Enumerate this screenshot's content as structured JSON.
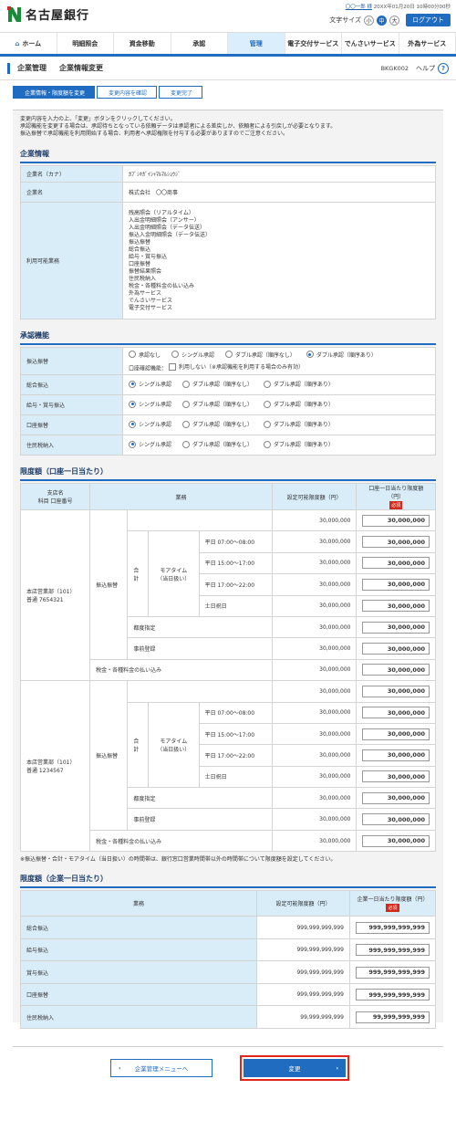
{
  "header": {
    "bank_name": "名古屋銀行",
    "user_name": "〇〇一郎 様",
    "last_login": "20XX年01月20日 10時00分00秒",
    "font_size_label": "文字サイズ",
    "font_sizes": [
      "小",
      "中",
      "大"
    ],
    "logout": "ログアウト"
  },
  "gnav": [
    "ホーム",
    "明細照会",
    "資金移動",
    "承認",
    "管理",
    "電子交付サービス",
    "でんさいサービス",
    "外為サービス"
  ],
  "page": {
    "title": "企業管理",
    "subtitle": "企業情報変更",
    "screen_id": "BKGK002",
    "help": "ヘルプ"
  },
  "steps": [
    "企業情報・限度額を変更",
    "変更内容を確認",
    "変更完了"
  ],
  "intro": [
    "変更内容を入力の上、「変更」ボタンをクリックしてください。",
    "承認機能を変更する場合は、承認待ちとなっている依頼データは承認者による差戻しか、依頼者による引戻しが必要となります。",
    "振込振替で承認機能を利用開始する場合、利用者へ承認権限を付与する必要がありますのでご注意ください。"
  ],
  "company": {
    "section": "企業情報",
    "rows": [
      {
        "label": "企業名（カナ）",
        "value": "ｶﾌﾞｼｷｶﾞｲｼｬﾏﾙﾏﾙｼｮｳｼﾞ"
      },
      {
        "label": "企業名",
        "value": "株式会社　〇〇商事"
      }
    ],
    "services_label": "利用可能業務",
    "services": [
      "残高照会（リアルタイム）",
      "入出金明細照会（アンサー）",
      "入出金明細照会（データ伝送）",
      "振込入金明細照会（データ伝送）",
      "振込振替",
      "総合振込",
      "給与・賞与振込",
      "口座振替",
      "振替結果照会",
      "住民税納入",
      "税金・各種料金の払い込み",
      "外為サービス",
      "でんさいサービス",
      "電子交付サービス"
    ]
  },
  "approval": {
    "section": "承認機能",
    "rows": [
      {
        "label": "振込振替",
        "options": [
          "承認なし",
          "シングル承認",
          "ダブル承認（順序なし）",
          "ダブル承認（順序あり）"
        ],
        "selected": 3,
        "sub_label": "口座確認機能：",
        "sub_check": "利用しない（※承認機能を利用する場合のみ有効）"
      },
      {
        "label": "総合振込",
        "options": [
          "シングル承認",
          "ダブル承認（順序なし）",
          "ダブル承認（順序あり）"
        ],
        "selected": 0
      },
      {
        "label": "給与・賞与振込",
        "options": [
          "シングル承認",
          "ダブル承認（順序なし）",
          "ダブル承認（順序あり）"
        ],
        "selected": 0
      },
      {
        "label": "口座振替",
        "options": [
          "シングル承認",
          "ダブル承認（順序なし）",
          "ダブル承認（順序あり）"
        ],
        "selected": 0
      },
      {
        "label": "住民税納入",
        "options": [
          "シングル承認",
          "ダブル承認（順序なし）",
          "ダブル承認（順序あり）"
        ],
        "selected": 0
      }
    ]
  },
  "account_limits": {
    "section": "限度額（口座一日当たり）",
    "col_branch": "支店名",
    "col_branch2": "科目 口座番号",
    "col_biz": "業務",
    "col_settable": "設定可能限度額（円）",
    "col_limit": "口座一日当たり限度額（円）",
    "required": "必須",
    "accounts": [
      {
        "branch": "本店営業部（101）",
        "acct": "普通 7654321"
      },
      {
        "branch": "本店営業部（101）",
        "acct": "普通 1234567"
      }
    ],
    "furikomi": "振込振替",
    "gokei": "合計",
    "moretime": "モアタイム",
    "moretime2": "（当日扱い）",
    "slots": [
      "平日 07:00～08:00",
      "平日 15:00～17:00",
      "平日 17:00～22:00",
      "土日祝日"
    ],
    "tsudo": "都度指定",
    "jizen": "事前登録",
    "zeikin": "税金・各種料金の払い込み",
    "amount": "30,000,000",
    "note": "※振込振替・合計・モアタイム（当日扱い）の時間帯は、銀行窓口営業時間帯以外の時間帯について限度額を設定してください。"
  },
  "company_limits": {
    "section": "限度額（企業一日当たり）",
    "col_biz": "業務",
    "col_settable": "設定可能限度額（円）",
    "col_limit": "企業一日当たり限度額（円）",
    "required": "必須",
    "rows": [
      {
        "label": "総合振込",
        "settable": "999,999,999,999",
        "value": "999,999,999,999"
      },
      {
        "label": "給与振込",
        "settable": "999,999,999,999",
        "value": "999,999,999,999"
      },
      {
        "label": "賞与振込",
        "settable": "999,999,999,999",
        "value": "999,999,999,999"
      },
      {
        "label": "口座振替",
        "settable": "999,999,999,999",
        "value": "999,999,999,999"
      },
      {
        "label": "住民税納入",
        "settable": "99,999,999,999",
        "value": "99,999,999,999"
      }
    ]
  },
  "buttons": {
    "back": "企業管理メニューへ",
    "submit": "変更"
  }
}
